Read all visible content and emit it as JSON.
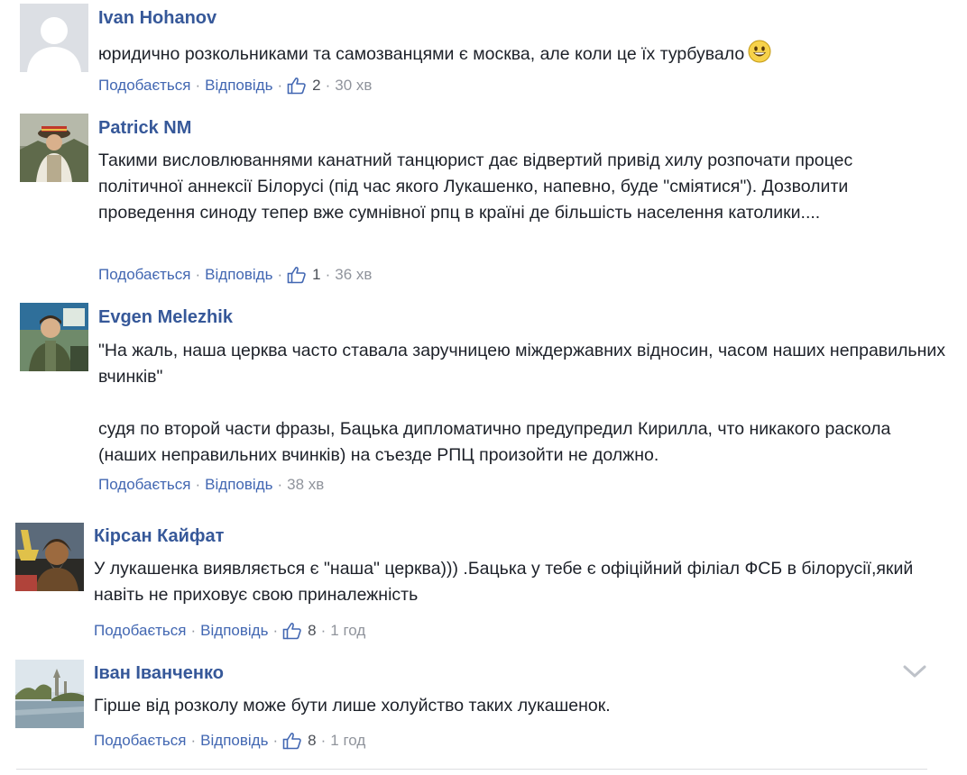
{
  "comments": [
    {
      "author": "Ivan Hohanov",
      "text": "юридично розкольниками та самозванцями є москва, але коли це їх турбувало",
      "emoji": "grinning-face",
      "like_label": "Подобається",
      "reply_label": "Відповідь",
      "likes": "2",
      "time": "30 хв"
    },
    {
      "author": "Patrick NM",
      "text": "Такими висловлюваннями канатний танцюрист дає відвертий привід хилу розпочати процес політичної аннексії Білорусі (під час якого Лукашенко, напевно, буде \"сміятися\"). Дозволити проведення синоду тепер вже сумнівної рпц в країні де більшість населення католики....",
      "like_label": "Подобається",
      "reply_label": "Відповідь",
      "likes": "1",
      "time": "36 хв"
    },
    {
      "author": "Evgen Melezhik",
      "text_line1": "\"На жаль, наша церква часто ставала заручницею міждержавних відносин, часом наших неправильних вчинків\"",
      "text_line2": "судя по второй части фразы, Бацька дипломатично предупредил Кирилла, что никакого раскола (наших неправильних вчинків) на съезде РПЦ произойти не должно.",
      "like_label": "Подобається",
      "reply_label": "Відповідь",
      "time": "38 хв"
    },
    {
      "author": "Кірсан Кайфат",
      "text": "У лукашенка виявляється є \"наша\" церква))) .Бацька у тебе є офіційний філіал ФСБ в білорусії,який навіть не приховує свою приналежність",
      "like_label": "Подобається",
      "reply_label": "Відповідь",
      "likes": "8",
      "time": "1 год"
    },
    {
      "author": "Іван Іванченко",
      "text": "Гірше від розколу може бути лише холуйство таких лукашенок.",
      "like_label": "Подобається",
      "reply_label": "Відповідь",
      "likes": "8",
      "time": "1 год"
    }
  ],
  "colors": {
    "author": "#365899",
    "link": "#4267b2",
    "meta": "#90949c",
    "text": "#1d2129"
  },
  "icons": {
    "like": "thumbs-up-icon",
    "menu": "chevron-down-icon",
    "default_avatar": "default-avatar-silhouette"
  }
}
